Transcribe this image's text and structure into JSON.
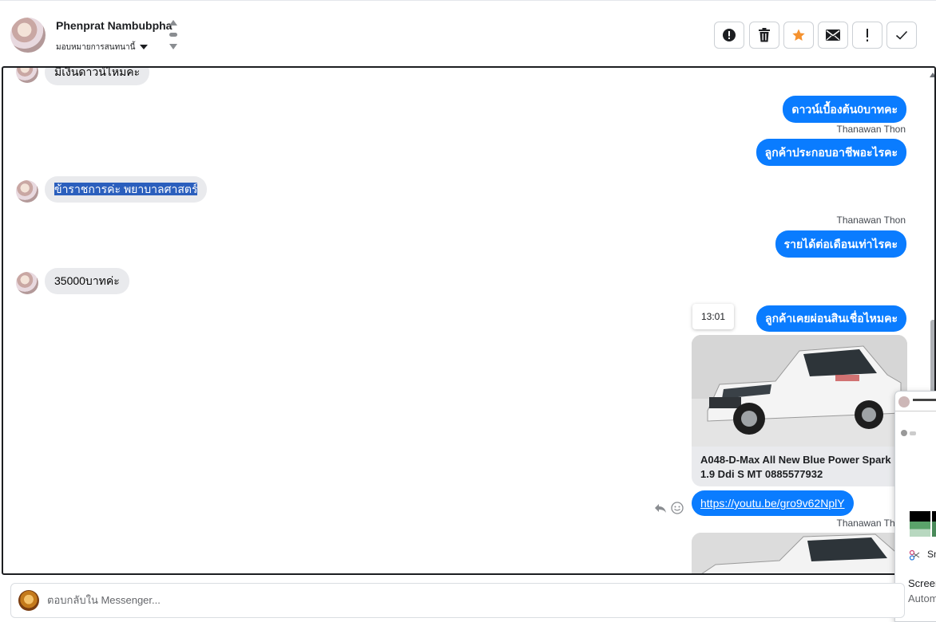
{
  "header": {
    "contact_name": "Phenprat Nambubpha",
    "assign_label": "มอบหมายการสนทนานี้",
    "toolbar": [
      {
        "icon": "alert-circle-icon",
        "action": "spam"
      },
      {
        "icon": "trash-icon",
        "action": "delete"
      },
      {
        "icon": "star-icon",
        "action": "star"
      },
      {
        "icon": "envelope-icon",
        "action": "mark-unread"
      },
      {
        "icon": "exclamation-icon",
        "action": "follow-up"
      },
      {
        "icon": "check-icon",
        "action": "done"
      }
    ],
    "star_color": "#f5922f"
  },
  "messages": [
    {
      "dir": "in",
      "text": "มีเงินดาวน์ไหมคะ"
    },
    {
      "dir": "out",
      "text": "ดาวน์เบื้องต้น0บาทคะ"
    },
    {
      "dir": "out",
      "sender": "Thanawan Thon",
      "text": "ลูกค้าประกอบอาชีพอะไรคะ"
    },
    {
      "dir": "in",
      "text": "ข้าราชการค่ะ พยาบาลศาสตร์",
      "selected": true
    },
    {
      "dir": "out",
      "sender": "Thanawan Thon",
      "text": "รายได้ต่อเดือนเท่าไรคะ"
    },
    {
      "dir": "in",
      "text": "35000บาทค่ะ"
    },
    {
      "dir": "out",
      "text": "ลูกค้าเคยผ่อนสินเชื่อไหมคะ",
      "time": "13:01"
    },
    {
      "dir": "out",
      "type": "card",
      "text": "A048-D-Max All New Blue Power Spark 1.9 Ddi S MT 0885577932"
    },
    {
      "dir": "out",
      "type": "link",
      "text": "https://youtu.be/gro9v62NplY"
    },
    {
      "dir": "out",
      "sender": "Thanawan Thon",
      "type": "card-image"
    }
  ],
  "composer": {
    "placeholder": "ตอบกลับใน Messenger..."
  },
  "popup": {
    "label_sn": "Sn",
    "label_screen": "Screen",
    "label_auto": "Autom"
  },
  "colors": {
    "outgoing_bubble": "#0a7cff",
    "incoming_bubble": "#e9eaed",
    "selection": "#2b5fbd"
  }
}
